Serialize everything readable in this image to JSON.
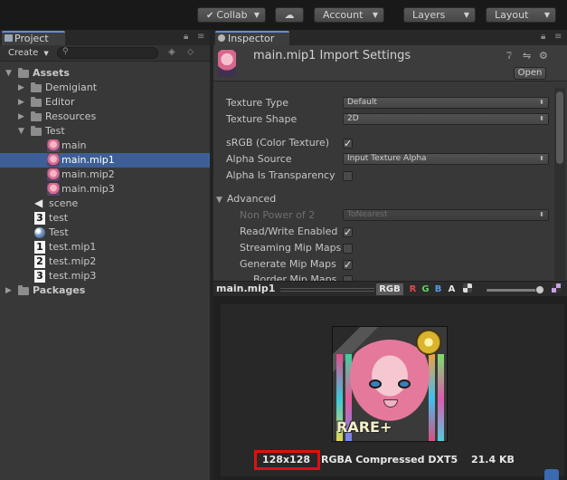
{
  "toolbar": {
    "collab": "Collab",
    "account": "Account",
    "layers": "Layers",
    "layout": "Layout"
  },
  "project": {
    "tab_label": "Project",
    "create_label": "Create",
    "tree": [
      {
        "label": "Assets",
        "depth": 0,
        "kind": "folder",
        "expanded": true,
        "bold": true
      },
      {
        "label": "Demigiant",
        "depth": 1,
        "kind": "folder",
        "expanded": false
      },
      {
        "label": "Editor",
        "depth": 1,
        "kind": "folder",
        "expanded": false
      },
      {
        "label": "Resources",
        "depth": 1,
        "kind": "folder",
        "expanded": false
      },
      {
        "label": "Test",
        "depth": 1,
        "kind": "folder",
        "expanded": true
      },
      {
        "label": "main",
        "depth": 2,
        "kind": "texture"
      },
      {
        "label": "main.mip1",
        "depth": 2,
        "kind": "texture",
        "selected": true
      },
      {
        "label": "main.mip2",
        "depth": 2,
        "kind": "texture"
      },
      {
        "label": "main.mip3",
        "depth": 2,
        "kind": "texture"
      },
      {
        "label": "scene",
        "depth": 1,
        "kind": "scene"
      },
      {
        "label": "test",
        "depth": 1,
        "kind": "num",
        "num": "3"
      },
      {
        "label": "Test",
        "depth": 1,
        "kind": "sphere"
      },
      {
        "label": "test.mip1",
        "depth": 1,
        "kind": "num",
        "num": "1"
      },
      {
        "label": "test.mip2",
        "depth": 1,
        "kind": "num",
        "num": "2"
      },
      {
        "label": "test.mip3",
        "depth": 1,
        "kind": "num",
        "num": "3"
      },
      {
        "label": "Packages",
        "depth": 0,
        "kind": "folder",
        "expanded": false,
        "bold": true
      }
    ]
  },
  "inspector": {
    "tab_label": "Inspector",
    "title": "main.mip1 Import Settings",
    "open_label": "Open",
    "texture_type_label": "Texture Type",
    "texture_type_value": "Default",
    "texture_shape_label": "Texture Shape",
    "texture_shape_value": "2D",
    "srgb_label": "sRGB (Color Texture)",
    "alpha_source_label": "Alpha Source",
    "alpha_source_value": "Input Texture Alpha",
    "alpha_transparency_label": "Alpha Is Transparency",
    "advanced_label": "Advanced",
    "npot_label": "Non Power of 2",
    "npot_value": "ToNearest",
    "readwrite_label": "Read/Write Enabled",
    "streaming_label": "Streaming Mip Maps",
    "genmip_label": "Generate Mip Maps",
    "border_label": "Border Mip Maps"
  },
  "preview": {
    "name": "main.mip1",
    "rgb": "RGB",
    "r": "R",
    "g": "G",
    "b": "B",
    "a": "A",
    "card_text": "RARE+",
    "size": "128x128",
    "format": "RGBA Compressed DXT5",
    "filesize": "21.4 KB"
  },
  "colors": {
    "selection": "#3e5f96",
    "highlight": "#e01010",
    "tab_accent": "#5b8fd6"
  }
}
